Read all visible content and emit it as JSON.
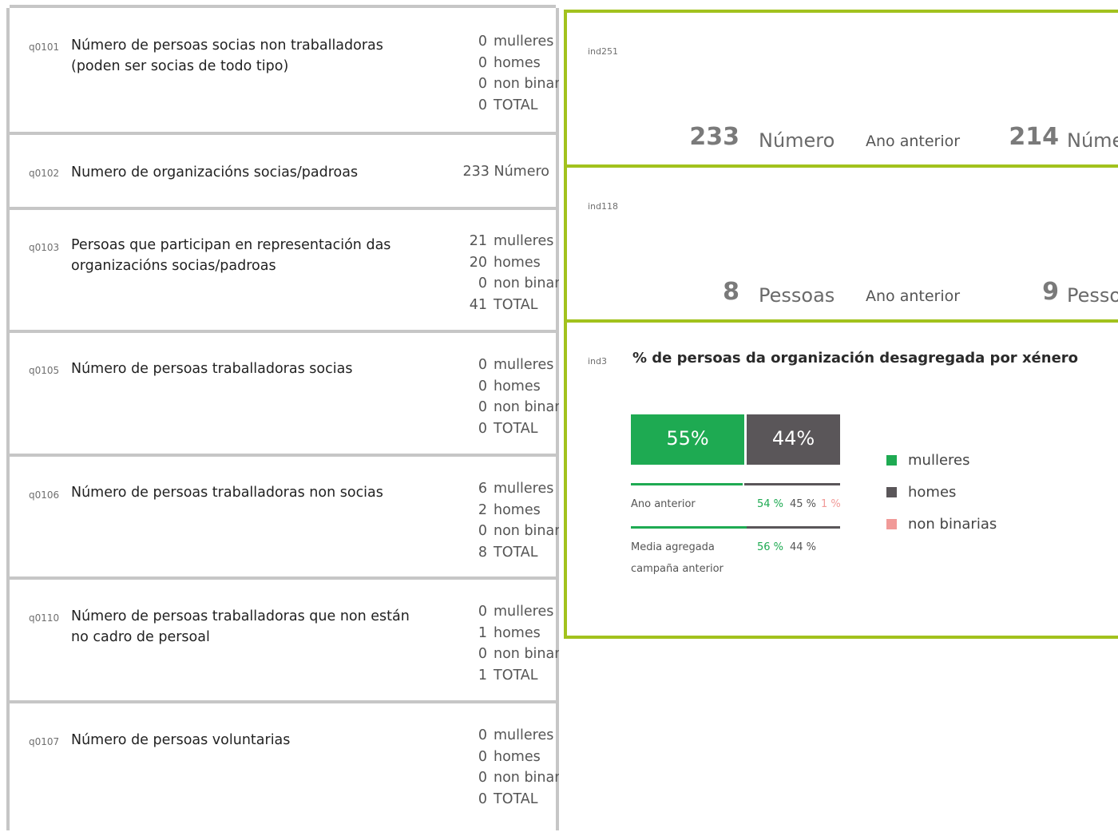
{
  "colors": {
    "green": "#1eaa52",
    "dark": "#5a5659",
    "pink": "#f19a98",
    "frame": "#a2c21d",
    "gray_border": "#c6c6c6"
  },
  "questions": [
    {
      "code": "q0101",
      "text": "Número de persoas socias non traballadoras (poden ser socias de todo tipo)",
      "values": [
        {
          "v": "0",
          "l": "mulleres"
        },
        {
          "v": "0",
          "l": "homes"
        },
        {
          "v": "0",
          "l": "non binarias"
        },
        {
          "v": "0",
          "l": "TOTAL"
        }
      ]
    },
    {
      "code": "q0102",
      "text": "Numero de organizacións socias/padroas",
      "single": "233 Número"
    },
    {
      "code": "q0103",
      "text": "Persoas que participan en representación das organizacións socias/padroas",
      "values": [
        {
          "v": "21",
          "l": "mulleres"
        },
        {
          "v": "20",
          "l": "homes"
        },
        {
          "v": "0",
          "l": "non binarias"
        },
        {
          "v": "41",
          "l": "TOTAL"
        }
      ]
    },
    {
      "code": "q0105",
      "text": "Número de persoas traballadoras socias",
      "values": [
        {
          "v": "0",
          "l": "mulleres"
        },
        {
          "v": "0",
          "l": "homes"
        },
        {
          "v": "0",
          "l": "non binarias"
        },
        {
          "v": "0",
          "l": "TOTAL"
        }
      ]
    },
    {
      "code": "q0106",
      "text": "Número de persoas traballadoras non socias",
      "values": [
        {
          "v": "6",
          "l": "mulleres"
        },
        {
          "v": "2",
          "l": "homes"
        },
        {
          "v": "0",
          "l": "non binarias"
        },
        {
          "v": "8",
          "l": "TOTAL"
        }
      ]
    },
    {
      "code": "q0110",
      "text": "Número de persoas traballadoras que non están no cadro de persoal",
      "values": [
        {
          "v": "0",
          "l": "mulleres"
        },
        {
          "v": "1",
          "l": "homes"
        },
        {
          "v": "0",
          "l": "non binarias"
        },
        {
          "v": "1",
          "l": "TOTAL"
        }
      ]
    },
    {
      "code": "q0107",
      "text": "Número de persoas voluntarias",
      "values": [
        {
          "v": "0",
          "l": "mulleres"
        },
        {
          "v": "0",
          "l": "homes"
        },
        {
          "v": "0",
          "l": "non binarias"
        },
        {
          "v": "0",
          "l": "TOTAL"
        }
      ]
    }
  ],
  "ind251": {
    "code": "ind251",
    "value": "233",
    "unit": "Número",
    "prev_label": "Ano anterior",
    "prev_value": "214",
    "prev_unit": "Número"
  },
  "ind118": {
    "code": "ind118",
    "value": "8",
    "unit": "Pessoas",
    "prev_label": "Ano anterior",
    "prev_value": "9",
    "prev_unit": "Pessoas"
  },
  "ind3": {
    "code": "ind3",
    "title": "% de persoas da organización desagregada por xénero",
    "current": {
      "mulleres_pct": 55,
      "homes_pct": 44,
      "mulleres_label": "55%",
      "homes_label": "44%"
    },
    "prev_label": "Ano anterior",
    "prev": {
      "mulleres": "54 %",
      "homes": "45 %",
      "non_binarias": "1 %"
    },
    "avg_label_1": "Media agregada",
    "avg_label_2": "campaña anterior",
    "avg": {
      "mulleres": "56 %",
      "homes": "44 %"
    },
    "legend": [
      "mulleres",
      "homes",
      "non binarias"
    ]
  }
}
